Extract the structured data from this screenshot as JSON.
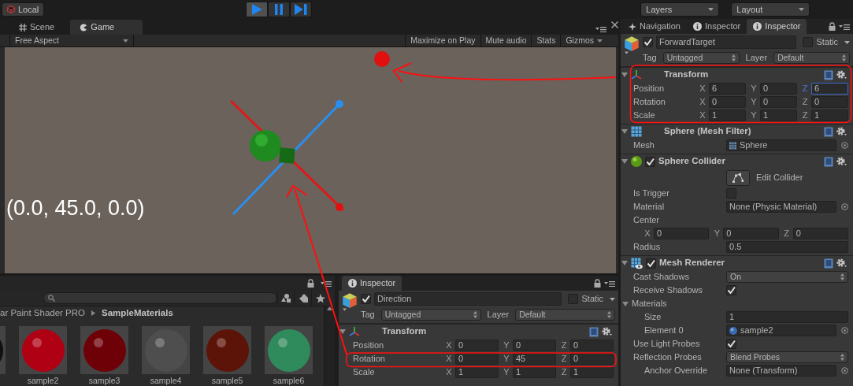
{
  "toolbar": {
    "local": "Local",
    "play_buttons": [
      {
        "kind": "play",
        "selected": true
      },
      {
        "kind": "pause",
        "selected": false
      },
      {
        "kind": "step",
        "selected": false
      }
    ],
    "layers": "Layers",
    "layout": "Layout"
  },
  "game_panel": {
    "tabs": [
      {
        "kind": "scene",
        "label": "Scene",
        "selected": false
      },
      {
        "kind": "game",
        "label": "Game",
        "selected": true
      }
    ],
    "aspect": "Free Aspect",
    "toggles": [
      "Maximize on Play",
      "Mute audio",
      "Stats"
    ],
    "gizmos": "Gizmos",
    "overlay_text": "(0.0, 45.0, 0.0)"
  },
  "project_panel": {
    "breadcrumb": [
      {
        "label": "ar Paint Shader PRO",
        "selected": false
      },
      {
        "label": "SampleMaterials",
        "selected": true
      }
    ],
    "assets": [
      {
        "name": "sample2",
        "color": "#b00014"
      },
      {
        "name": "sample3",
        "color": "#6e0008"
      },
      {
        "name": "sample4",
        "color": "#4e4e4e"
      },
      {
        "name": "sample5",
        "color": "#5c1408"
      },
      {
        "name": "sample6",
        "color": "#2f8a5c"
      }
    ]
  },
  "bottom_inspector": {
    "tabs": [
      {
        "kind": "inspector",
        "label": "Inspector",
        "selected": true
      }
    ],
    "object": {
      "active": true,
      "name": "Direction",
      "static": false,
      "static_label": "Static",
      "tag_label": "Tag",
      "tag": "Untagged",
      "layer_label": "Layer",
      "layer": "Default"
    },
    "components": [
      {
        "kind": "transform",
        "title": "Transform",
        "expanded": true,
        "properties": [
          {
            "kind": "vector",
            "label": "Position",
            "values": [
              {
                "axis": "X",
                "value": "0",
                "focused": false
              },
              {
                "axis": "Y",
                "value": "0",
                "focused": false
              },
              {
                "axis": "Z",
                "value": "0",
                "focused": false
              }
            ]
          },
          {
            "kind": "vector",
            "label": "Rotation",
            "values": [
              {
                "axis": "X",
                "value": "0",
                "focused": false
              },
              {
                "axis": "Y",
                "value": "45",
                "focused": false
              },
              {
                "axis": "Z",
                "value": "0",
                "focused": false
              }
            ]
          },
          {
            "kind": "vector",
            "label": "Scale",
            "values": [
              {
                "axis": "X",
                "value": "1",
                "focused": false
              },
              {
                "axis": "Y",
                "value": "1",
                "focused": false
              },
              {
                "axis": "Z",
                "value": "1",
                "focused": false
              }
            ]
          }
        ]
      }
    ]
  },
  "right_inspector": {
    "tabs": [
      {
        "kind": "navigation",
        "label": "Navigation",
        "selected": false
      },
      {
        "kind": "inspector",
        "label": "Inspector",
        "selected": false
      },
      {
        "kind": "inspector",
        "label": "Inspector",
        "selected": true
      }
    ],
    "object": {
      "active": true,
      "name": "ForwardTarget",
      "static": false,
      "static_label": "Static",
      "tag_label": "Tag",
      "tag": "Untagged",
      "layer_label": "Layer",
      "layer": "Default"
    },
    "components": [
      {
        "kind": "transform",
        "title": "Transform",
        "expanded": true,
        "properties": [
          {
            "kind": "vector",
            "label": "Position",
            "values": [
              {
                "axis": "X",
                "value": "6",
                "focused": false
              },
              {
                "axis": "Y",
                "value": "0",
                "focused": false
              },
              {
                "axis": "Z",
                "value": "6",
                "focused": true
              }
            ]
          },
          {
            "kind": "vector",
            "label": "Rotation",
            "values": [
              {
                "axis": "X",
                "value": "0",
                "focused": false
              },
              {
                "axis": "Y",
                "value": "0",
                "focused": false
              },
              {
                "axis": "Z",
                "value": "0",
                "focused": false
              }
            ]
          },
          {
            "kind": "vector",
            "label": "Scale",
            "values": [
              {
                "axis": "X",
                "value": "1",
                "focused": false
              },
              {
                "axis": "Y",
                "value": "1",
                "focused": false
              },
              {
                "axis": "Z",
                "value": "1",
                "focused": false
              }
            ]
          }
        ]
      },
      {
        "kind": "mesh_filter",
        "title": "Sphere (Mesh Filter)",
        "expanded": true,
        "properties": [
          {
            "kind": "mesh_object",
            "label": "Mesh",
            "value": "Sphere"
          }
        ]
      },
      {
        "kind": "sphere_collider",
        "title": "Sphere Collider",
        "enabled": true,
        "expanded": true,
        "properties": [
          {
            "kind": "button",
            "label": "Edit Collider"
          },
          {
            "kind": "checkbox",
            "label": "Is Trigger",
            "checked": false
          },
          {
            "kind": "object",
            "label": "Material",
            "value": "None (Physic Material)"
          },
          {
            "kind": "vector_block",
            "label": "Center",
            "values": [
              {
                "axis": "X",
                "value": "0",
                "focused": false
              },
              {
                "axis": "Y",
                "value": "0",
                "focused": false
              },
              {
                "axis": "Z",
                "value": "0",
                "focused": false
              }
            ]
          },
          {
            "kind": "text",
            "label": "Radius",
            "value": "0.5"
          }
        ]
      },
      {
        "kind": "mesh_renderer",
        "title": "Mesh Renderer",
        "enabled": true,
        "expanded": true,
        "properties": [
          {
            "kind": "dropdown",
            "label": "Cast Shadows",
            "value": "On"
          },
          {
            "kind": "checkbox",
            "label": "Receive Shadows",
            "checked": true
          },
          {
            "kind": "foldout",
            "label": "Materials",
            "expanded": true,
            "children": [
              {
                "kind": "text",
                "label": "Size",
                "value": "1"
              },
              {
                "kind": "material_object",
                "label": "Element 0",
                "value": "sample2"
              }
            ]
          },
          {
            "kind": "checkbox",
            "label": "Use Light Probes",
            "checked": true
          },
          {
            "kind": "dropdown",
            "label": "Reflection Probes",
            "value": "Blend Probes",
            "children": [
              {
                "kind": "object",
                "label": "Anchor Override",
                "value": "None (Transform)"
              }
            ]
          }
        ]
      }
    ]
  }
}
